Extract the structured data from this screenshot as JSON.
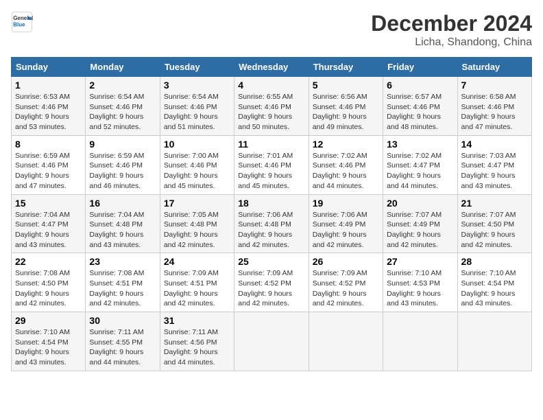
{
  "header": {
    "logo_line1": "General",
    "logo_line2": "Blue",
    "month": "December 2024",
    "location": "Licha, Shandong, China"
  },
  "weekdays": [
    "Sunday",
    "Monday",
    "Tuesday",
    "Wednesday",
    "Thursday",
    "Friday",
    "Saturday"
  ],
  "weeks": [
    [
      {
        "day": "1",
        "sunrise": "Sunrise: 6:53 AM",
        "sunset": "Sunset: 4:46 PM",
        "daylight": "Daylight: 9 hours and 53 minutes."
      },
      {
        "day": "2",
        "sunrise": "Sunrise: 6:54 AM",
        "sunset": "Sunset: 4:46 PM",
        "daylight": "Daylight: 9 hours and 52 minutes."
      },
      {
        "day": "3",
        "sunrise": "Sunrise: 6:54 AM",
        "sunset": "Sunset: 4:46 PM",
        "daylight": "Daylight: 9 hours and 51 minutes."
      },
      {
        "day": "4",
        "sunrise": "Sunrise: 6:55 AM",
        "sunset": "Sunset: 4:46 PM",
        "daylight": "Daylight: 9 hours and 50 minutes."
      },
      {
        "day": "5",
        "sunrise": "Sunrise: 6:56 AM",
        "sunset": "Sunset: 4:46 PM",
        "daylight": "Daylight: 9 hours and 49 minutes."
      },
      {
        "day": "6",
        "sunrise": "Sunrise: 6:57 AM",
        "sunset": "Sunset: 4:46 PM",
        "daylight": "Daylight: 9 hours and 48 minutes."
      },
      {
        "day": "7",
        "sunrise": "Sunrise: 6:58 AM",
        "sunset": "Sunset: 4:46 PM",
        "daylight": "Daylight: 9 hours and 47 minutes."
      }
    ],
    [
      {
        "day": "8",
        "sunrise": "Sunrise: 6:59 AM",
        "sunset": "Sunset: 4:46 PM",
        "daylight": "Daylight: 9 hours and 47 minutes."
      },
      {
        "day": "9",
        "sunrise": "Sunrise: 6:59 AM",
        "sunset": "Sunset: 4:46 PM",
        "daylight": "Daylight: 9 hours and 46 minutes."
      },
      {
        "day": "10",
        "sunrise": "Sunrise: 7:00 AM",
        "sunset": "Sunset: 4:46 PM",
        "daylight": "Daylight: 9 hours and 45 minutes."
      },
      {
        "day": "11",
        "sunrise": "Sunrise: 7:01 AM",
        "sunset": "Sunset: 4:46 PM",
        "daylight": "Daylight: 9 hours and 45 minutes."
      },
      {
        "day": "12",
        "sunrise": "Sunrise: 7:02 AM",
        "sunset": "Sunset: 4:46 PM",
        "daylight": "Daylight: 9 hours and 44 minutes."
      },
      {
        "day": "13",
        "sunrise": "Sunrise: 7:02 AM",
        "sunset": "Sunset: 4:47 PM",
        "daylight": "Daylight: 9 hours and 44 minutes."
      },
      {
        "day": "14",
        "sunrise": "Sunrise: 7:03 AM",
        "sunset": "Sunset: 4:47 PM",
        "daylight": "Daylight: 9 hours and 43 minutes."
      }
    ],
    [
      {
        "day": "15",
        "sunrise": "Sunrise: 7:04 AM",
        "sunset": "Sunset: 4:47 PM",
        "daylight": "Daylight: 9 hours and 43 minutes."
      },
      {
        "day": "16",
        "sunrise": "Sunrise: 7:04 AM",
        "sunset": "Sunset: 4:48 PM",
        "daylight": "Daylight: 9 hours and 43 minutes."
      },
      {
        "day": "17",
        "sunrise": "Sunrise: 7:05 AM",
        "sunset": "Sunset: 4:48 PM",
        "daylight": "Daylight: 9 hours and 42 minutes."
      },
      {
        "day": "18",
        "sunrise": "Sunrise: 7:06 AM",
        "sunset": "Sunset: 4:48 PM",
        "daylight": "Daylight: 9 hours and 42 minutes."
      },
      {
        "day": "19",
        "sunrise": "Sunrise: 7:06 AM",
        "sunset": "Sunset: 4:49 PM",
        "daylight": "Daylight: 9 hours and 42 minutes."
      },
      {
        "day": "20",
        "sunrise": "Sunrise: 7:07 AM",
        "sunset": "Sunset: 4:49 PM",
        "daylight": "Daylight: 9 hours and 42 minutes."
      },
      {
        "day": "21",
        "sunrise": "Sunrise: 7:07 AM",
        "sunset": "Sunset: 4:50 PM",
        "daylight": "Daylight: 9 hours and 42 minutes."
      }
    ],
    [
      {
        "day": "22",
        "sunrise": "Sunrise: 7:08 AM",
        "sunset": "Sunset: 4:50 PM",
        "daylight": "Daylight: 9 hours and 42 minutes."
      },
      {
        "day": "23",
        "sunrise": "Sunrise: 7:08 AM",
        "sunset": "Sunset: 4:51 PM",
        "daylight": "Daylight: 9 hours and 42 minutes."
      },
      {
        "day": "24",
        "sunrise": "Sunrise: 7:09 AM",
        "sunset": "Sunset: 4:51 PM",
        "daylight": "Daylight: 9 hours and 42 minutes."
      },
      {
        "day": "25",
        "sunrise": "Sunrise: 7:09 AM",
        "sunset": "Sunset: 4:52 PM",
        "daylight": "Daylight: 9 hours and 42 minutes."
      },
      {
        "day": "26",
        "sunrise": "Sunrise: 7:09 AM",
        "sunset": "Sunset: 4:52 PM",
        "daylight": "Daylight: 9 hours and 42 minutes."
      },
      {
        "day": "27",
        "sunrise": "Sunrise: 7:10 AM",
        "sunset": "Sunset: 4:53 PM",
        "daylight": "Daylight: 9 hours and 43 minutes."
      },
      {
        "day": "28",
        "sunrise": "Sunrise: 7:10 AM",
        "sunset": "Sunset: 4:54 PM",
        "daylight": "Daylight: 9 hours and 43 minutes."
      }
    ],
    [
      {
        "day": "29",
        "sunrise": "Sunrise: 7:10 AM",
        "sunset": "Sunset: 4:54 PM",
        "daylight": "Daylight: 9 hours and 43 minutes."
      },
      {
        "day": "30",
        "sunrise": "Sunrise: 7:11 AM",
        "sunset": "Sunset: 4:55 PM",
        "daylight": "Daylight: 9 hours and 44 minutes."
      },
      {
        "day": "31",
        "sunrise": "Sunrise: 7:11 AM",
        "sunset": "Sunset: 4:56 PM",
        "daylight": "Daylight: 9 hours and 44 minutes."
      },
      null,
      null,
      null,
      null
    ]
  ]
}
